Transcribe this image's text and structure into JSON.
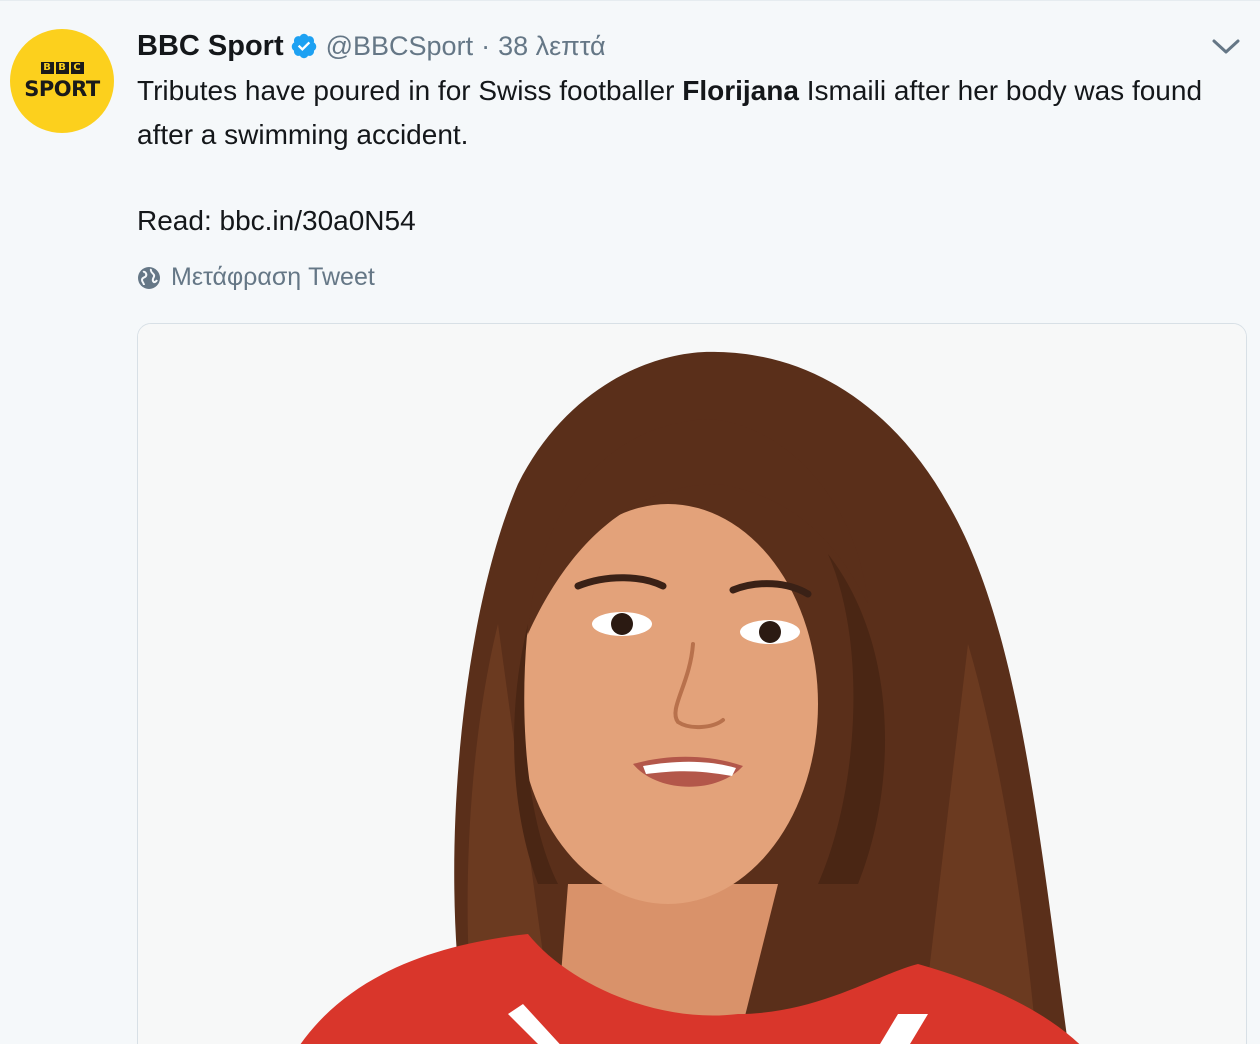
{
  "account": {
    "avatar_label_top": "BBC",
    "avatar_label_bottom": "SPORT",
    "display_name": "BBC Sport",
    "handle": "@BBCSport",
    "separator": "·",
    "timestamp": "38 λεπτά"
  },
  "tweet": {
    "text_before": "Tributes have poured in for Swiss footballer ",
    "text_bold": "Florijana",
    "text_after": " Ismaili after her body was found after a swimming accident.",
    "read_label": "Read: ",
    "read_link": "bbc.in/30a0N54"
  },
  "translate_label": "Μετάφραση Tweet",
  "icons": {
    "verified": "verified-badge-icon",
    "caret": "chevron-down-icon",
    "globe": "globe-icon"
  },
  "colors": {
    "avatar_bg": "#fcd01d",
    "verified_blue": "#1da1f2",
    "secondary_text": "#657786",
    "background": "#f5f8fa"
  }
}
